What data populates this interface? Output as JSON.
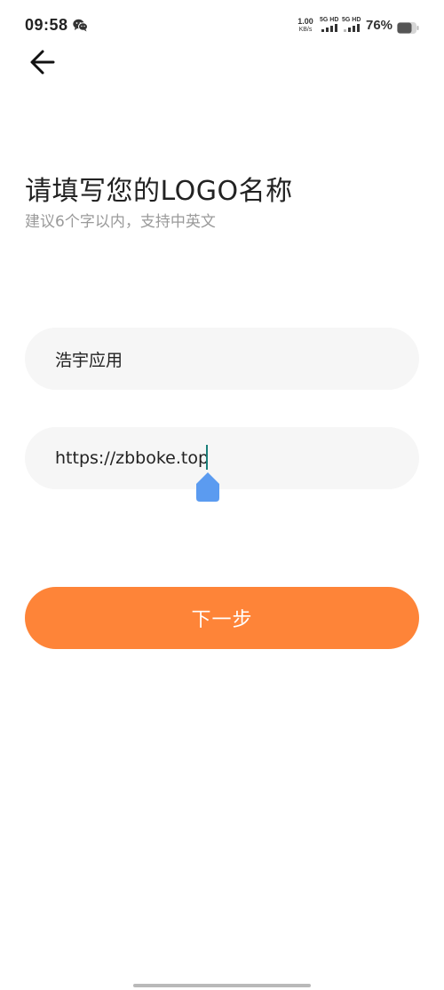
{
  "status_bar": {
    "time": "09:58",
    "app_icon": "wechat-icon",
    "net_speed_value": "1.00",
    "net_speed_unit": "KB/s",
    "sim1_label": "5G HD",
    "sim2_label": "5G HD",
    "battery_percent": "76%",
    "battery_level": 0.76
  },
  "header": {
    "back_icon": "back-arrow-icon"
  },
  "main": {
    "title": "请填写您的LOGO名称",
    "subtitle": "建议6个字以内，支持中英文",
    "name_input_value": "浩宇应用",
    "url_input_value": "https://zbboke.top",
    "next_button_label": "下一步"
  },
  "colors": {
    "accent": "#fe8438",
    "field_bg": "#f6f6f6",
    "caret": "#1a7f7a",
    "caret_handle": "#5b9bf0",
    "subtitle": "#9a9a9a"
  }
}
